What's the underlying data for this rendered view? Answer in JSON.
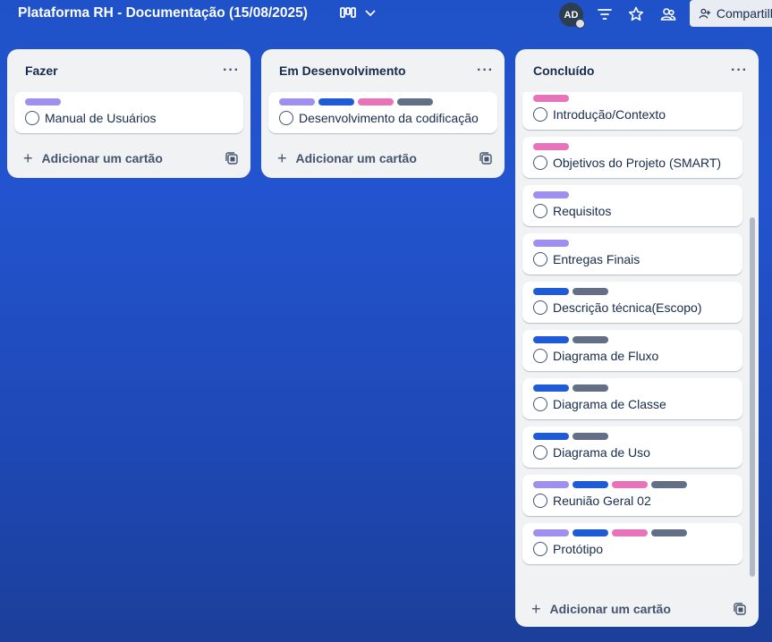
{
  "board": {
    "title": "Plataforma RH - Documentação (15/08/2025)"
  },
  "header": {
    "avatar_initials": "AD",
    "share_label": "Compartilhar"
  },
  "colors": {
    "purple": "#9f8fef",
    "blue": "#1f5bd6",
    "pink": "#e774bb",
    "gray": "#626f86"
  },
  "lists": [
    {
      "title": "Fazer",
      "cards": [
        {
          "title": "Manual de Usuários",
          "labels": [
            "purple"
          ]
        }
      ],
      "add_label": "Adicionar um cartão"
    },
    {
      "title": "Em Desenvolvimento",
      "cards": [
        {
          "title": "Desenvolvimento da codificação",
          "labels": [
            "purple",
            "blue",
            "pink",
            "gray"
          ]
        }
      ],
      "add_label": "Adicionar um cartão"
    },
    {
      "title": "Concluído",
      "cards": [
        {
          "title": "Introdução/Contexto",
          "labels": [
            "pink"
          ]
        },
        {
          "title": "Objetivos do Projeto (SMART)",
          "labels": [
            "pink"
          ]
        },
        {
          "title": "Requisitos",
          "labels": [
            "purple"
          ]
        },
        {
          "title": "Entregas Finais",
          "labels": [
            "purple"
          ]
        },
        {
          "title": "Descrição técnica(Escopo)",
          "labels": [
            "blue",
            "gray"
          ]
        },
        {
          "title": "Diagrama de Fluxo",
          "labels": [
            "blue",
            "gray"
          ]
        },
        {
          "title": "Diagrama de Classe",
          "labels": [
            "blue",
            "gray"
          ]
        },
        {
          "title": "Diagrama de Uso",
          "labels": [
            "blue",
            "gray"
          ]
        },
        {
          "title": "Reunião Geral 02",
          "labels": [
            "purple",
            "blue",
            "pink",
            "gray"
          ]
        },
        {
          "title": "Protótipo",
          "labels": [
            "purple",
            "blue",
            "pink",
            "gray"
          ]
        }
      ],
      "add_label": "Adicionar um cartão"
    }
  ]
}
